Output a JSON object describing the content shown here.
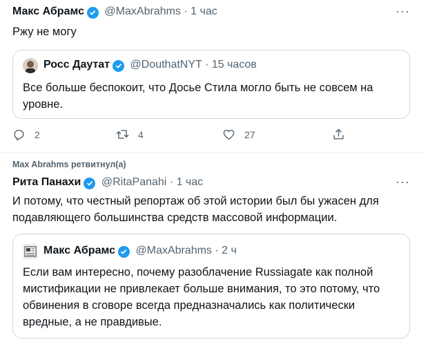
{
  "tweet1": {
    "author_name": "Макс Абрамс",
    "handle_time": "@MaxAbrahms · 1 час",
    "text": "Ржу не могу",
    "quote": {
      "author_name": "Росс Даутат",
      "handle_time": "@DouthatNYT · 15 часов",
      "text": "Все больше беспокоит, что Досье Стила могло быть не совсем на уровне."
    },
    "actions": {
      "replies": "2",
      "retweets": "4",
      "likes": "27"
    }
  },
  "tweet2": {
    "retweet_label": "Max Abrahms ретвитнул(а)",
    "author_name": "Рита Панахи",
    "handle_time": "@RitaPanahi · 1 час",
    "text": "И потому, что честный репортаж об этой истории был бы ужасен для подавляющего большинства средств массовой информации.",
    "quote": {
      "author_name": "Макс Абрамс",
      "handle_time": "@MaxAbrahms · 2 ч",
      "text": "Если вам интересно, почему разоблачение Russiagate как полной мистификации не привлекает больше внимания, то это потому, что обвинения в сговоре всегда предназначались как политически вредные, а не правдивые."
    }
  },
  "colors": {
    "verified": "#1d9bf0",
    "secondary_text": "#536471",
    "border": "#cfd9de"
  },
  "icons": [
    "verified-badge-icon",
    "more-options-icon",
    "reply-icon",
    "retweet-icon",
    "like-icon",
    "share-icon"
  ]
}
